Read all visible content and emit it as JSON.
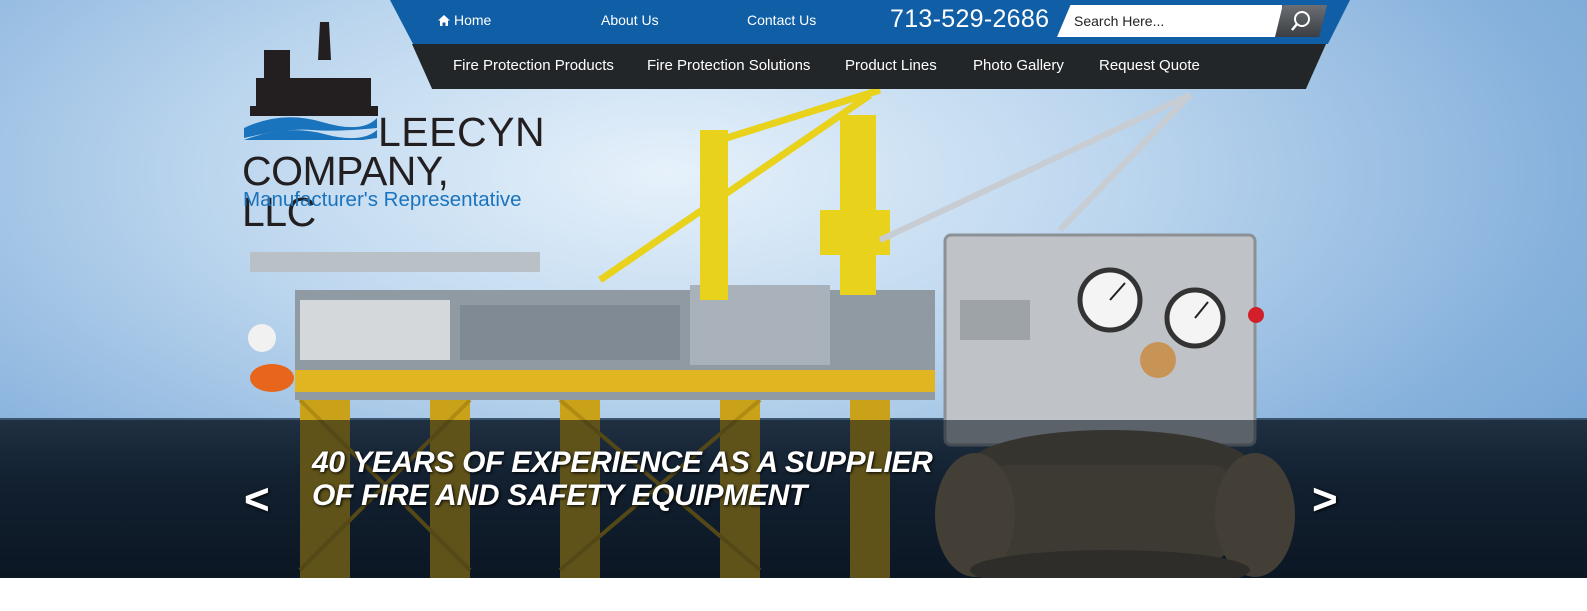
{
  "top_nav": {
    "home": "Home",
    "about": "About Us",
    "contact": "Contact Us",
    "phone": "713-529-2686"
  },
  "search": {
    "placeholder": "Search Here..."
  },
  "main_nav": {
    "items": [
      "Fire Protection Products",
      "Fire Protection Solutions",
      "Product Lines",
      "Photo Gallery",
      "Request Quote"
    ]
  },
  "logo": {
    "line1": "LEECYN",
    "line2": "COMPANY, LLC",
    "line3": "Manufacturer's Representative"
  },
  "slider": {
    "headline_line1": "40 YEARS OF EXPERIENCE AS A SUPPLIER",
    "headline_line2": "OF FIRE AND SAFETY EQUIPMENT",
    "prev": "<",
    "next": ">"
  },
  "colors": {
    "top_bar": "#0f5ea6",
    "main_nav": "#232629",
    "logo_blue": "#1a74bd"
  },
  "icons": [
    "home-icon",
    "search-icon",
    "oil-rig-logo-icon"
  ]
}
